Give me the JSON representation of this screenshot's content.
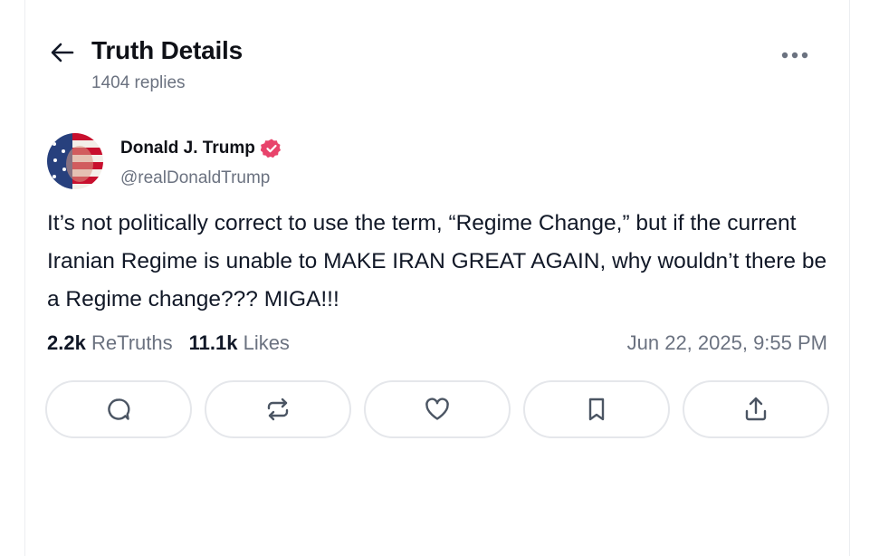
{
  "header": {
    "title": "Truth Details",
    "replies": "1404 replies"
  },
  "post": {
    "author_name": "Donald J. Trump",
    "handle": "@realDonaldTrump",
    "verified": true,
    "text": "It’s not politically correct to use the term, “Regime Change,” but if the current Iranian Regime is unable to MAKE IRAN GREAT AGAIN, why wouldn’t there be a Regime change??? MIGA!!!",
    "retruths_count": "2.2k",
    "retruths_label": "ReTruths",
    "likes_count": "11.1k",
    "likes_label": "Likes",
    "timestamp": "Jun 22, 2025, 9:55 PM"
  },
  "actions": [
    {
      "icon": "reply-icon"
    },
    {
      "icon": "retruth-icon"
    },
    {
      "icon": "heart-icon"
    },
    {
      "icon": "bookmark-icon"
    },
    {
      "icon": "share-icon"
    }
  ],
  "colors": {
    "verified_badge": "#e8436b",
    "muted_text": "#6b7280",
    "border": "#e5e7eb"
  }
}
